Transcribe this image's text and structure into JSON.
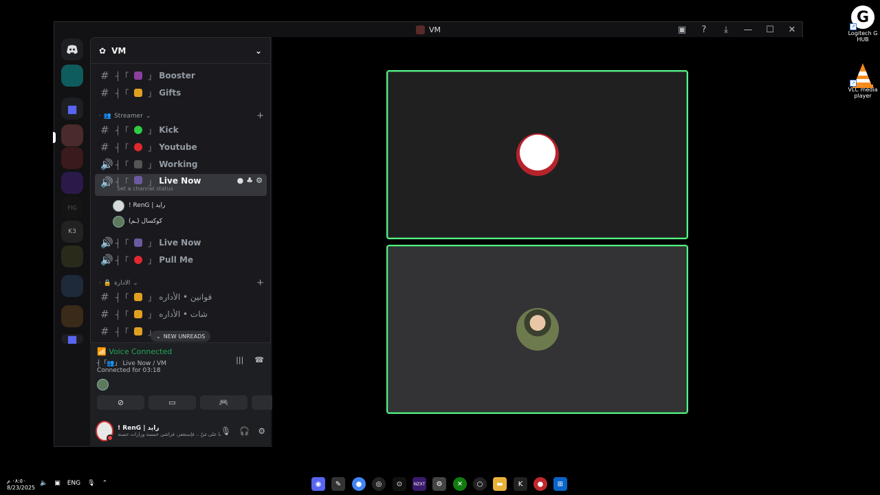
{
  "desktop": {
    "icons": [
      {
        "label": "Logitech G HUB"
      },
      {
        "label": "VLC media player"
      }
    ]
  },
  "window": {
    "title": "VM"
  },
  "server": {
    "name": "VM"
  },
  "channels": {
    "booster": "Booster",
    "gifts": "Gifts",
    "category_streamer": "Streamer",
    "kick": "Kick",
    "youtube": "Youtube",
    "working": "Working",
    "live_now": "Live Now",
    "live_now_status": "Set a channel status",
    "voice_users": [
      "! RenG | رايد",
      "(ـم) كوكسال"
    ],
    "live_now_2": "Live Now",
    "pull_me": "Pull Me",
    "category_admin": "الادارة",
    "admin_rules": "قوانين • الأداره",
    "admin_chat": "شات • الأداره",
    "admin_partial": "ر"
  },
  "new_unreads": "NEW UNREADS",
  "voice_panel": {
    "title": "Voice Connected",
    "channel": "Live Now / VM",
    "connected_for": "Connected for 03:18"
  },
  "user": {
    "name": "! RenG | رايد",
    "status": "ما على مَنْ .. فإستغفر، فراشي خمسة وزارات حسنة..."
  },
  "taskbar": {
    "time": "٠٨:٥٠ م",
    "date": "8/23/2025",
    "lang": "ENG"
  },
  "colors": {
    "speaking_border": "#57f287",
    "voice_connected": "#23a55a",
    "accent": "#5865f2"
  }
}
